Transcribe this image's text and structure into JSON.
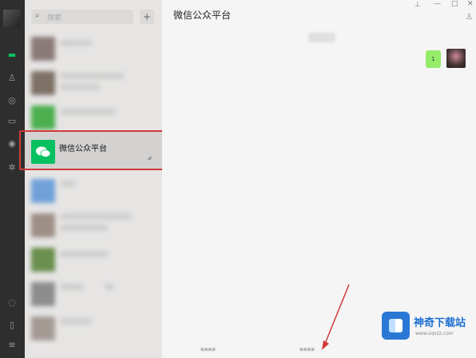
{
  "app": {
    "title": "微信公众平台"
  },
  "sidebar": {
    "icons": [
      "chat-icon",
      "contacts-icon",
      "favorites-icon",
      "files-icon",
      "moments-icon",
      "star-icon",
      "mini-program-icon",
      "phone-icon",
      "menu-icon"
    ]
  },
  "conversation_list": {
    "search_placeholder": "搜索",
    "add_label": "+",
    "highlighted_item": {
      "name": "微信公众平台",
      "brand_color": "#07c160"
    }
  },
  "chat": {
    "bubble_text": "1",
    "bubble_color": "#95ec69",
    "highlight_box_color": "#d33a3a",
    "arrow_color": "#d33a3a"
  },
  "watermark": {
    "brand": "神奇下载站",
    "url": "www.sqxzz.com",
    "color": "#1d6fd1"
  }
}
